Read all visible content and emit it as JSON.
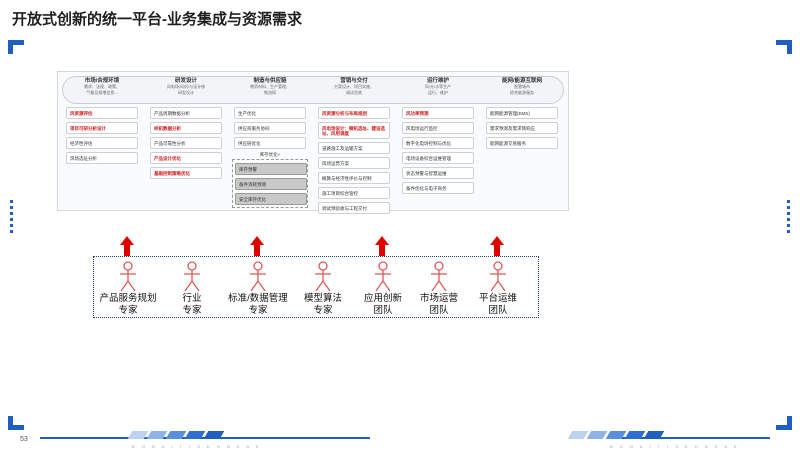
{
  "page": {
    "title": "开放式创新的统一平台-业务集成与资源需求",
    "page_number": "53",
    "footer_text": "B O N A I T I S E H N E A E"
  },
  "architecture": {
    "columns": [
      {
        "header": "市场/合规环境",
        "sub": "需求、法规、政策、",
        "sub2": "气象及倾增信息...",
        "items": [
          {
            "label": "风资源评估",
            "red": true
          },
          {
            "label": "项目可研分析设计",
            "red": true
          },
          {
            "label": "经济性评估",
            "red": false
          },
          {
            "label": "风场选址分析",
            "red": false
          }
        ]
      },
      {
        "header": "研发设计",
        "sub": "风电场/风机/与设计修",
        "sub2": "研发设计",
        "items": [
          {
            "label": "产品周期数据分析",
            "red": false
          },
          {
            "label": "样机数据分析",
            "red": true
          },
          {
            "label": "产品可靠性分析",
            "red": false
          },
          {
            "label": "产品设计优化",
            "red": true
          },
          {
            "label": "基础控制策略优化",
            "red": true
          }
        ]
      },
      {
        "header": "制造与供应链",
        "sub": "物资材料、生产管理、",
        "sub2": "物流网",
        "items": [
          {
            "label": "生产优化",
            "red": false
          },
          {
            "label": "供应商服务协同",
            "red": false
          },
          {
            "label": "供应链优化",
            "red": false
          }
        ],
        "subgroup_label": "库存优化+",
        "subgroup_items": [
          "库存预警",
          "备件消耗预测",
          "安全库存优化"
        ]
      },
      {
        "header": "营销与交付",
        "sub": "方案设计、项目实施、",
        "sub2": "调试验收",
        "items": [
          {
            "label": "风资源分析与布局规划",
            "red": true
          },
          {
            "label": "风电场设计：微机选址、建设选址、风用调度",
            "red": true
          },
          {
            "label": "道路施工及运输方案",
            "red": false
          },
          {
            "label": "风场运营方案",
            "red": false
          },
          {
            "label": "概算与经济性评价与控制",
            "red": false
          },
          {
            "label": "施工项目综合管控",
            "red": false
          },
          {
            "label": "调试预验收与工程交付",
            "red": false
          }
        ]
      },
      {
        "header": "运行维护",
        "sub": "风/光/水等生产",
        "sub2": "运行、维护",
        "items": [
          {
            "label": "风功率预测",
            "red": true
          },
          {
            "label": "风电场运行监控",
            "red": false
          },
          {
            "label": "数字化电场控制与优化",
            "red": false
          },
          {
            "label": "电场设备综合运维管理",
            "red": false
          },
          {
            "label": "状态预警与智慧运维",
            "red": false
          },
          {
            "label": "备件优化与电子商务",
            "red": false
          }
        ]
      },
      {
        "header": "能网/能源互联网",
        "sub": "智慧城市",
        "sub2": "综合能源服务",
        "items": [
          {
            "label": "能网能源管理(EMS)",
            "red": false
          },
          {
            "label": "需求预测及需求侧响应",
            "red": false
          },
          {
            "label": "能网能源交易服务",
            "red": false
          }
        ]
      }
    ]
  },
  "roles": [
    {
      "label": "产品服务规划",
      "label2": "专家",
      "arrow": true
    },
    {
      "label": "行业",
      "label2": "专家",
      "arrow": false
    },
    {
      "label": "标准/数据管理",
      "label2": "专家",
      "arrow": true
    },
    {
      "label": "模型算法",
      "label2": "专家",
      "arrow": false
    },
    {
      "label": "应用创新",
      "label2": "团队",
      "arrow": true
    },
    {
      "label": "市场运营",
      "label2": "团队",
      "arrow": false
    },
    {
      "label": "平台运维",
      "label2": "团队",
      "arrow": true
    }
  ],
  "colors": {
    "accent": "#1f5fbf",
    "arrow": "#e00000",
    "person": "#e05a5a",
    "red_text": "#d11a1a"
  }
}
